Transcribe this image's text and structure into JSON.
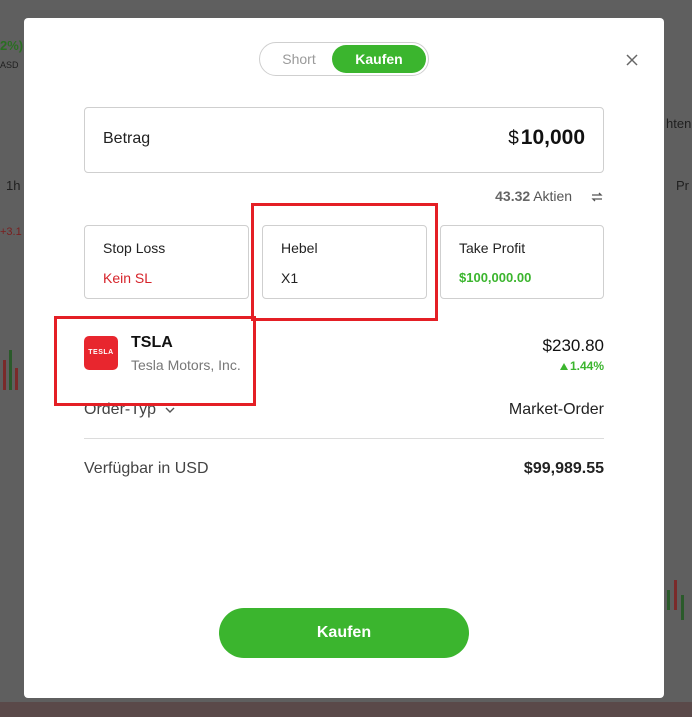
{
  "background": {
    "fragments": [
      "2%)",
      "ASD",
      "1h",
      "+3.1",
      "hten",
      "Pr"
    ]
  },
  "toggle": {
    "short_label": "Short",
    "buy_label": "Kaufen",
    "active": "Kaufen"
  },
  "close_icon": "close-icon",
  "amount": {
    "label": "Betrag",
    "currency_symbol": "$",
    "value": "10,000"
  },
  "shares": {
    "count": "43.32",
    "unit": "Aktien",
    "swap_icon": "swap-icon"
  },
  "cards": {
    "stop_loss": {
      "title": "Stop Loss",
      "value": "Kein SL"
    },
    "leverage": {
      "title": "Hebel",
      "value": "X1"
    },
    "take_profit": {
      "title": "Take Profit",
      "value": "$100,000.00"
    }
  },
  "instrument": {
    "logo_text": "TESLA",
    "ticker": "TSLA",
    "name": "Tesla Motors, Inc.",
    "price": "$230.80",
    "change": "1.44%"
  },
  "order_type": {
    "label": "Order-Typ",
    "value": "Market-Order"
  },
  "available": {
    "label": "Verfügbar in USD",
    "value": "$99,989.55"
  },
  "submit": {
    "label": "Kaufen"
  },
  "colors": {
    "accent_green": "#3bb52e",
    "danger_red": "#d6232a",
    "highlight_red": "#e41f25"
  }
}
